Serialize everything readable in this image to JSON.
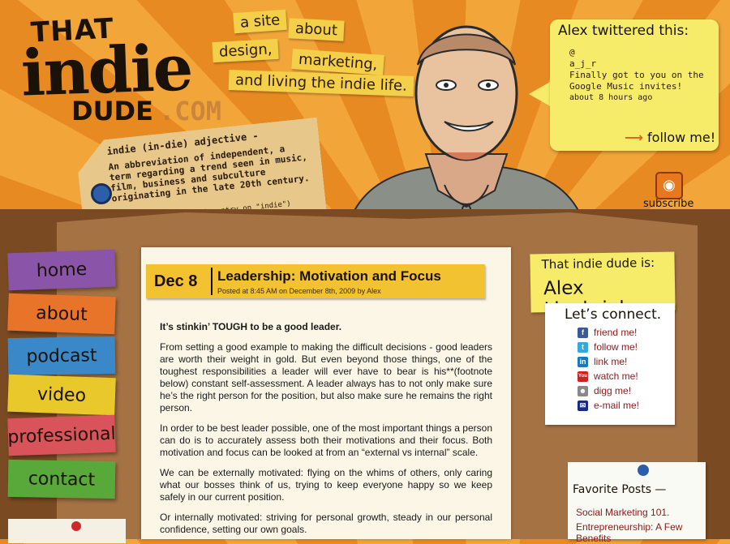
{
  "logo": {
    "that": "THAT",
    "indie": "indie",
    "dude": "DUDE",
    "com": ".COM"
  },
  "tagline": [
    "a site",
    "about",
    "design,",
    "marketing,",
    "and living the indie life."
  ],
  "definition": {
    "headword": "indie (in-die) adjective -",
    "text": "An abbreviation of independent, a term regarding a trend seen in music, film, business and subculture originating in the late 20th century.",
    "source": "(source: Wikipedia entry on \"indie\")"
  },
  "twitter": {
    "title": "Alex twittered this:",
    "at": "@",
    "handle": "a_j_r",
    "tweet": "Finally got to you on the Google Music invites!",
    "time": "about 8 hours ago",
    "follow": "follow me!",
    "arrow": "⟶"
  },
  "subscribe": {
    "label": "subscribe",
    "icon": "rss-icon"
  },
  "nav": [
    {
      "label": "home",
      "color": "#8a54a8"
    },
    {
      "label": "about",
      "color": "#e8742a"
    },
    {
      "label": "podcast",
      "color": "#3a88c8"
    },
    {
      "label": "video",
      "color": "#e8c82a"
    },
    {
      "label": "professional",
      "color": "#d8545a"
    },
    {
      "label": "contact",
      "color": "#58a83a"
    }
  ],
  "post": {
    "date": "Dec 8",
    "title": "Leadership: Motivation and Focus",
    "posted": "Posted at 8:45 AM on December 8th, 2009 by Alex",
    "lead": "It’s stinkin’ TOUGH to be a good leader.",
    "paragraphs": [
      "From setting a good example to making the difficult decisions - good leaders are worth their weight in gold.  But even beyond those things, one of the toughest responsibilities a leader will ever have to bear is his**(footnote below) constant self-assessment.  A leader always has to not only make sure he’s the right person for the position, but also make sure he remains the right person.",
      "In order to be best leader possible, one of the most important things a person can do is to accurately assess both their motivations and their focus.  Both motivation and focus can be looked at from an “external vs internal” scale.",
      "We can be externally motivated: flying on the whims of others, only caring what our bosses think of us, trying to keep everyone happy so we keep safely in our current position.",
      "Or internally motivated: striving for personal growth, steady in our personal confidence, setting our own goals."
    ]
  },
  "sidebar": {
    "is_label": "That indie dude is:",
    "name": "Alex Linebrink",
    "connect_title": "Let’s connect.",
    "links": [
      {
        "label": "friend me!",
        "icon": "f",
        "color": "#3b5998"
      },
      {
        "label": "follow me!",
        "icon": "t",
        "color": "#33aadd"
      },
      {
        "label": "link me!",
        "icon": "in",
        "color": "#1a7ab8"
      },
      {
        "label": "watch me!",
        "icon": "You",
        "color": "#cc2222"
      },
      {
        "label": "digg me!",
        "icon": "☻",
        "color": "#888888"
      },
      {
        "label": "e-mail me!",
        "icon": "✉",
        "color": "#1a2a88"
      }
    ],
    "favorite_title": "Favorite Posts —",
    "favorites": [
      "Social Marketing 101.",
      "Entrepreneurship: A Few Benefits"
    ]
  }
}
